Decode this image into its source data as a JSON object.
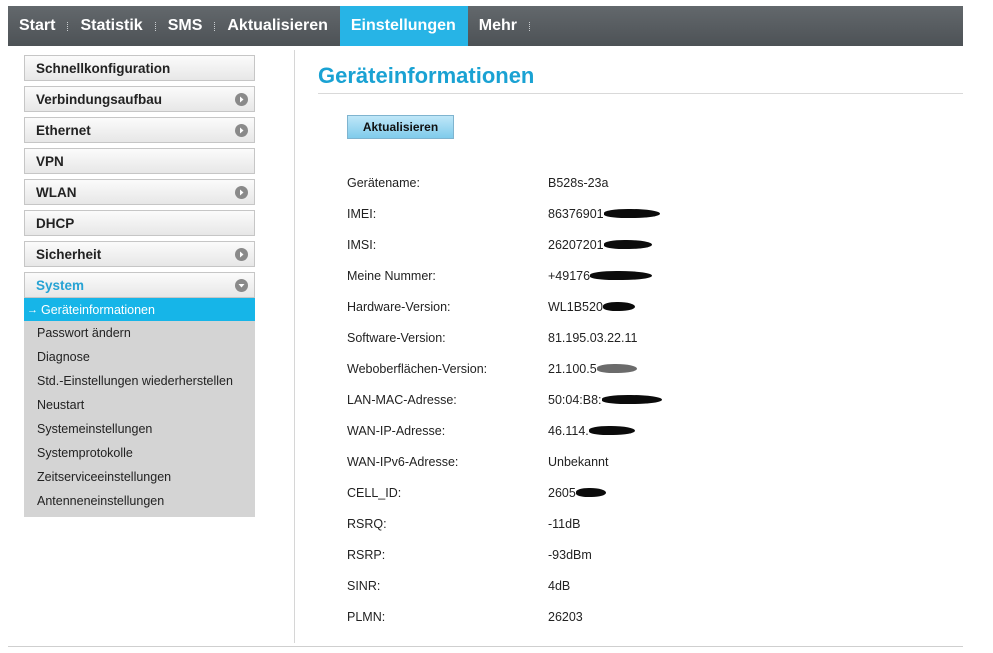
{
  "nav": {
    "items": [
      {
        "label": "Start"
      },
      {
        "label": "Statistik"
      },
      {
        "label": "SMS"
      },
      {
        "label": "Aktualisieren"
      },
      {
        "label": "Einstellungen"
      },
      {
        "label": "Mehr"
      }
    ],
    "active": "Einstellungen"
  },
  "sidebar": {
    "groups": [
      {
        "label": "Schnellkonfiguration"
      },
      {
        "label": "Verbindungsaufbau"
      },
      {
        "label": "Ethernet"
      },
      {
        "label": "VPN"
      },
      {
        "label": "WLAN"
      },
      {
        "label": "DHCP"
      },
      {
        "label": "Sicherheit"
      },
      {
        "label": "System"
      }
    ],
    "system_items": [
      {
        "label": "Geräteinformationen"
      },
      {
        "label": "Passwort ändern"
      },
      {
        "label": "Diagnose"
      },
      {
        "label": "Std.-Einstellungen wiederherstellen"
      },
      {
        "label": "Neustart"
      },
      {
        "label": "Systemeinstellungen"
      },
      {
        "label": "Systemprotokolle"
      },
      {
        "label": "Zeitserviceeinstellungen"
      },
      {
        "label": "Antenneneinstellungen"
      }
    ],
    "active_arrow": "→"
  },
  "main": {
    "title": "Geräteinformationen",
    "refresh_label": "Aktualisieren",
    "rows": [
      {
        "label": "Gerätename:",
        "value": "B528s-23a"
      },
      {
        "label": "IMEI:",
        "value": "86376901"
      },
      {
        "label": "IMSI:",
        "value": "26207201"
      },
      {
        "label": "Meine Nummer:",
        "value": "+49176"
      },
      {
        "label": "Hardware-Version:",
        "value": "WL1B520"
      },
      {
        "label": "Software-Version:",
        "value": "81.195.03.22.11"
      },
      {
        "label": "Weboberflächen-Version:",
        "value": "21.100.5"
      },
      {
        "label": "LAN-MAC-Adresse:",
        "value": "50:04:B8:"
      },
      {
        "label": "WAN-IP-Adresse:",
        "value": "46.114."
      },
      {
        "label": "WAN-IPv6-Adresse:",
        "value": "Unbekannt"
      },
      {
        "label": "CELL_ID:",
        "value": "2605"
      },
      {
        "label": "RSRQ:",
        "value": "-11dB"
      },
      {
        "label": "RSRP:",
        "value": "-93dBm"
      },
      {
        "label": "SINR:",
        "value": "4dB"
      },
      {
        "label": "PLMN:",
        "value": "26203"
      }
    ]
  },
  "colors": {
    "accent": "#27b4e6",
    "title": "#1aa2d3",
    "nav_bg": "#555a5e",
    "submenu_bg": "#d4d4d4"
  }
}
